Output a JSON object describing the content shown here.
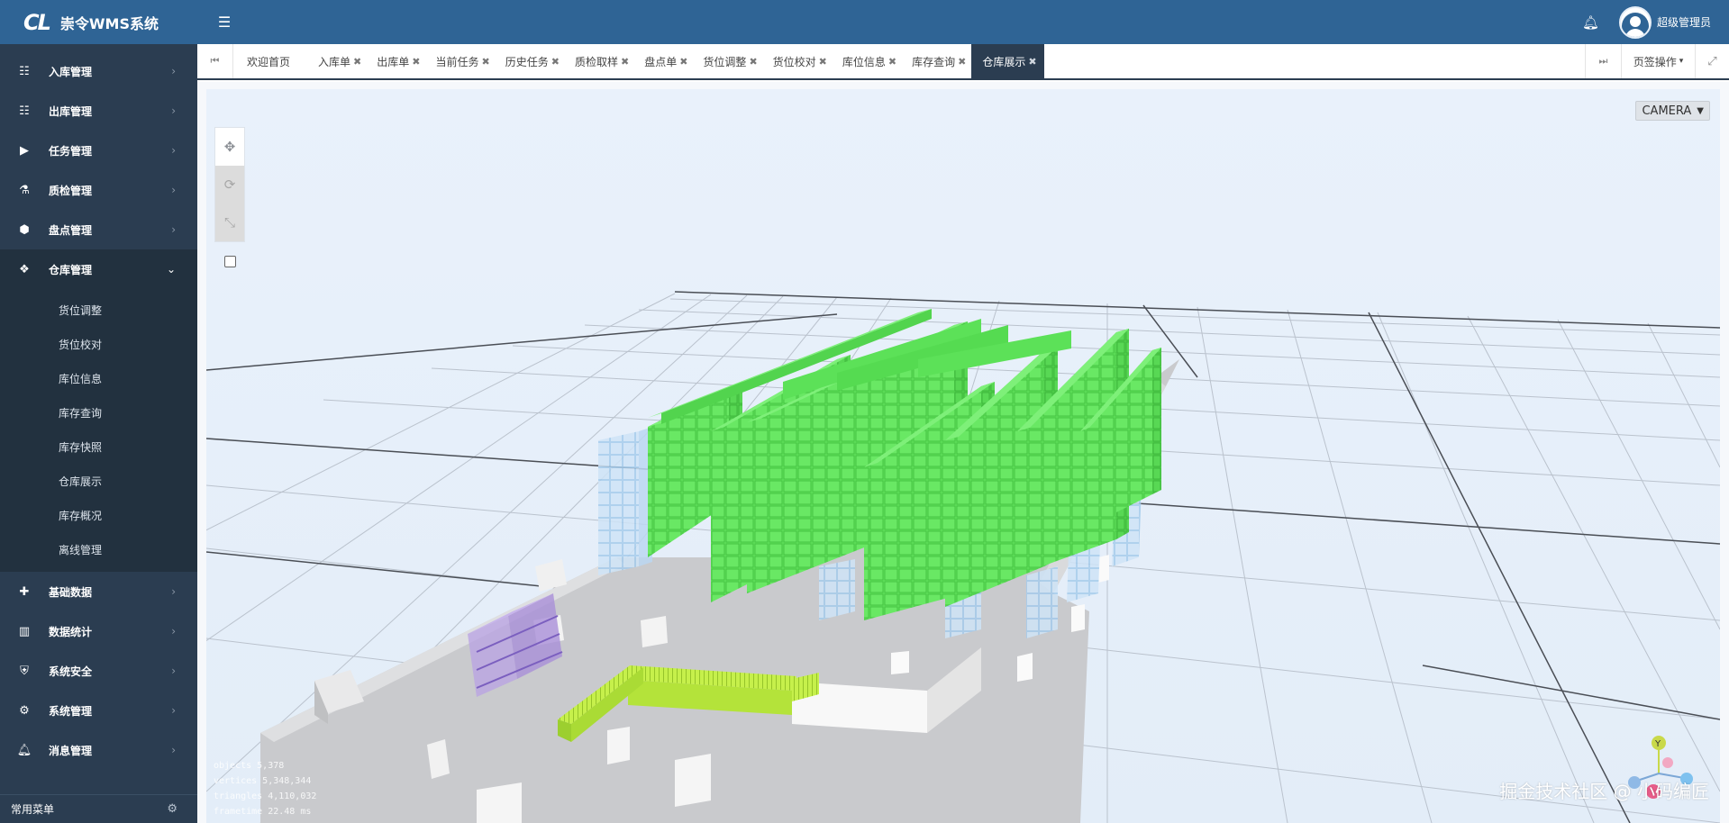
{
  "app": {
    "logo_text": "CL",
    "title": "崇令WMS系统",
    "menu_toggle_icon": "hamburger-icon"
  },
  "header": {
    "notification_icon": "bell-icon",
    "username": "超级管理员"
  },
  "sidebar": {
    "items": [
      {
        "label": "入库管理",
        "icon": "list-icon"
      },
      {
        "label": "出库管理",
        "icon": "list-icon"
      },
      {
        "label": "任务管理",
        "icon": "play-icon"
      },
      {
        "label": "质检管理",
        "icon": "flask-icon"
      },
      {
        "label": "盘点管理",
        "icon": "cube-icon"
      },
      {
        "label": "仓库管理",
        "icon": "cubes-icon",
        "expanded": true
      }
    ],
    "submenu": [
      "货位调整",
      "货位校对",
      "库位信息",
      "库存查询",
      "库存快照",
      "仓库展示",
      "库存概况",
      "离线管理"
    ],
    "items_after": [
      {
        "label": "基础数据",
        "icon": "puzzle-icon"
      },
      {
        "label": "数据统计",
        "icon": "bar-chart-icon"
      },
      {
        "label": "系统安全",
        "icon": "shield-icon"
      },
      {
        "label": "系统管理",
        "icon": "gears-icon"
      },
      {
        "label": "消息管理",
        "icon": "bell-icon"
      }
    ],
    "footer_label": "常用菜单"
  },
  "tabs": {
    "home": "欢迎首页",
    "list": [
      "入库单",
      "出库单",
      "当前任务",
      "历史任务",
      "质检取样",
      "盘点单",
      "货位调整",
      "货位校对",
      "库位信息",
      "库存查询"
    ],
    "active": "仓库展示",
    "ops_label": "页签操作"
  },
  "viewer": {
    "camera_label": "CAMERA",
    "stats": [
      "objects  5,378",
      "vertices  5,348,344",
      "triangles  4,110,032",
      "frametime  22.48 ms"
    ],
    "watermark": "掘金技术社区 @ 小码编匠",
    "colors": {
      "rack_green": "#5fe05a",
      "rack_empty": "#b9d9f4",
      "platform": "#c9cacd",
      "conveyor": "#c6f04b",
      "shelf_purple": "#a98fd8",
      "background": "#e9f1fb"
    }
  }
}
